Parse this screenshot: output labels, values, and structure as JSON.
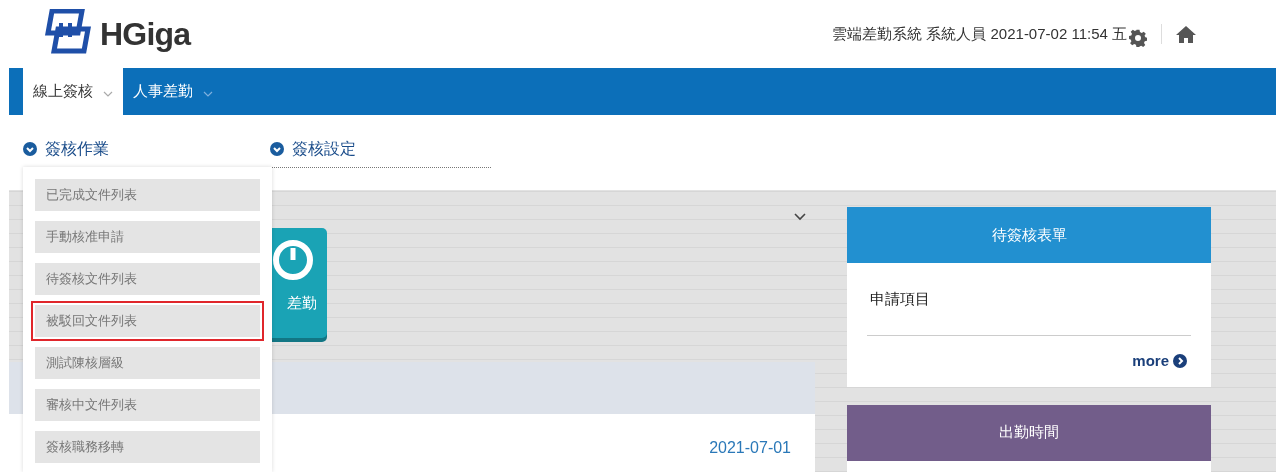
{
  "header": {
    "brand": "HGiga",
    "info": "雲端差勤系統 系統人員 2021-07-02 11:54 五"
  },
  "nav_tabs": [
    {
      "label": "線上簽核",
      "selected": true
    },
    {
      "label": "人事差勤",
      "selected": false
    }
  ],
  "sections": [
    {
      "label": "簽核作業"
    },
    {
      "label": "簽核設定"
    }
  ],
  "dropdown_items": [
    {
      "label": "已完成文件列表",
      "highlighted": false
    },
    {
      "label": "手動核准申請",
      "highlighted": false
    },
    {
      "label": "待簽核文件列表",
      "highlighted": false
    },
    {
      "label": "被駁回文件列表",
      "highlighted": true
    },
    {
      "label": "測試陳核層級",
      "highlighted": false
    },
    {
      "label": "審核中文件列表",
      "highlighted": false
    },
    {
      "label": "簽核職務移轉",
      "highlighted": false
    }
  ],
  "tile": {
    "label": "差勤"
  },
  "list_date": "2021-07-01",
  "panels": [
    {
      "title": "待簽核表單",
      "color": "#2290d0",
      "rows": [
        "申請項目"
      ],
      "more": "more"
    },
    {
      "title": "出勤時間",
      "color": "#725d8a"
    }
  ]
}
